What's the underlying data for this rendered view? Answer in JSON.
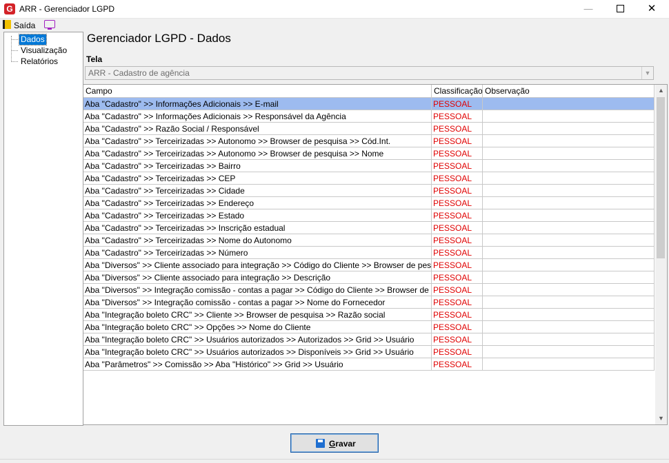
{
  "window": {
    "title": "ARR - Gerenciador LGPD",
    "app_icon": "G",
    "minimize_symbol": "—",
    "close_symbol": "✕"
  },
  "menu": {
    "exit_label": "Saída",
    "exit_icon": "exit-door-icon",
    "second_icon": "monitor-icon"
  },
  "tree": {
    "items": [
      {
        "label": "Dados",
        "selected": true
      },
      {
        "label": "Visualização",
        "selected": false
      },
      {
        "label": "Relatórios",
        "selected": false
      }
    ]
  },
  "main": {
    "heading": "Gerenciador LGPD - Dados",
    "tela_label": "Tela",
    "tela_value": "ARR - Cadastro de agência",
    "dropdown_arrow": "▼"
  },
  "grid": {
    "headers": [
      "Campo",
      "Classificação",
      "Observação"
    ],
    "rows": [
      {
        "campo": "Aba \"Cadastro\" >> Informações Adicionais >> E-mail",
        "classificacao": "PESSOAL",
        "observacao": "",
        "selected": true
      },
      {
        "campo": "Aba \"Cadastro\" >> Informações Adicionais >> Responsável da Agência",
        "classificacao": "PESSOAL",
        "observacao": ""
      },
      {
        "campo": "Aba \"Cadastro\" >> Razão Social / Responsável",
        "classificacao": "PESSOAL",
        "observacao": ""
      },
      {
        "campo": "Aba \"Cadastro\" >> Terceirizadas >> Autonomo >> Browser de pesquisa >> Cód.Int.",
        "classificacao": "PESSOAL",
        "observacao": ""
      },
      {
        "campo": "Aba \"Cadastro\" >> Terceirizadas >> Autonomo >> Browser de pesquisa >> Nome",
        "classificacao": "PESSOAL",
        "observacao": ""
      },
      {
        "campo": "Aba \"Cadastro\" >> Terceirizadas >> Bairro",
        "classificacao": "PESSOAL",
        "observacao": ""
      },
      {
        "campo": "Aba \"Cadastro\" >> Terceirizadas >> CEP",
        "classificacao": "PESSOAL",
        "observacao": ""
      },
      {
        "campo": "Aba \"Cadastro\" >> Terceirizadas >> Cidade",
        "classificacao": "PESSOAL",
        "observacao": ""
      },
      {
        "campo": "Aba \"Cadastro\" >> Terceirizadas >> Endereço",
        "classificacao": "PESSOAL",
        "observacao": ""
      },
      {
        "campo": "Aba \"Cadastro\" >> Terceirizadas >> Estado",
        "classificacao": "PESSOAL",
        "observacao": ""
      },
      {
        "campo": "Aba \"Cadastro\" >> Terceirizadas >> Inscrição estadual",
        "classificacao": "PESSOAL",
        "observacao": ""
      },
      {
        "campo": "Aba \"Cadastro\" >> Terceirizadas >> Nome do  Autonomo",
        "classificacao": "PESSOAL",
        "observacao": ""
      },
      {
        "campo": "Aba \"Cadastro\" >> Terceirizadas >> Número",
        "classificacao": "PESSOAL",
        "observacao": ""
      },
      {
        "campo": "Aba \"Diversos\" >> Cliente associado para integração >> Código do Cliente >> Browser de pesquisa >> ...",
        "classificacao": "PESSOAL",
        "observacao": ""
      },
      {
        "campo": "Aba \"Diversos\" >> Cliente associado para integração >> Descrição",
        "classificacao": "PESSOAL",
        "observacao": ""
      },
      {
        "campo": "Aba \"Diversos\" >> Integração comissão - contas a pagar >> Código do Cliente >> Browser de pesquisa ...",
        "classificacao": "PESSOAL",
        "observacao": ""
      },
      {
        "campo": "Aba \"Diversos\" >> Integração comissão - contas a pagar >> Nome do Fornecedor",
        "classificacao": "PESSOAL",
        "observacao": ""
      },
      {
        "campo": "Aba \"Integração boleto CRC\" >> Cliente >> Browser de pesquisa >> Razão social",
        "classificacao": "PESSOAL",
        "observacao": ""
      },
      {
        "campo": "Aba \"Integração boleto CRC\" >> Opções >> Nome do Cliente",
        "classificacao": "PESSOAL",
        "observacao": ""
      },
      {
        "campo": "Aba \"Integração boleto CRC\" >> Usuários autorizados >> Autorizados >> Grid >> Usuário",
        "classificacao": "PESSOAL",
        "observacao": ""
      },
      {
        "campo": "Aba \"Integração boleto CRC\" >> Usuários autorizados >> Disponíveis >> Grid >> Usuário",
        "classificacao": "PESSOAL",
        "observacao": ""
      },
      {
        "campo": "Aba \"Parâmetros\" >> Comissão >> Aba \"Histórico\" >> Grid >> Usuário",
        "classificacao": "PESSOAL",
        "observacao": ""
      }
    ],
    "scroll_up": "▲",
    "scroll_down": "▼"
  },
  "footer": {
    "save_label_underlined": "G",
    "save_label_rest": "ravar",
    "save_icon": "floppy-disk-icon"
  },
  "colors": {
    "selection_row": "#9dbbef",
    "classification_text": "#e00000",
    "tree_selection": "#0078d7"
  }
}
